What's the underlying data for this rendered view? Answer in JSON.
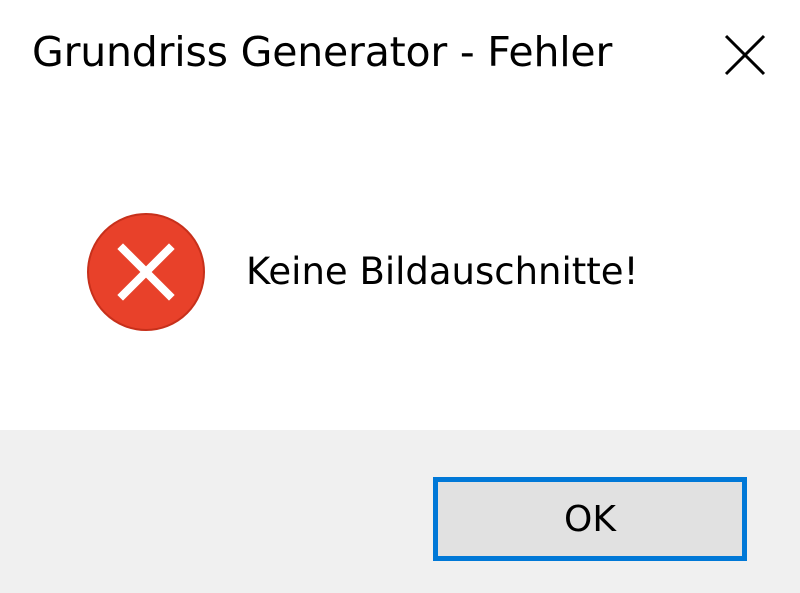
{
  "window": {
    "title": "Grundriss Generator - Fehler",
    "close_icon": "close-icon"
  },
  "message": {
    "icon": "error-icon",
    "text": "Keine Bildauschnitte!"
  },
  "buttons": {
    "ok_label": "OK"
  },
  "colors": {
    "error_red": "#e8412a",
    "accent_blue": "#0078d7",
    "footer_bg": "#f0f0f0",
    "button_bg": "#e1e1e1"
  }
}
